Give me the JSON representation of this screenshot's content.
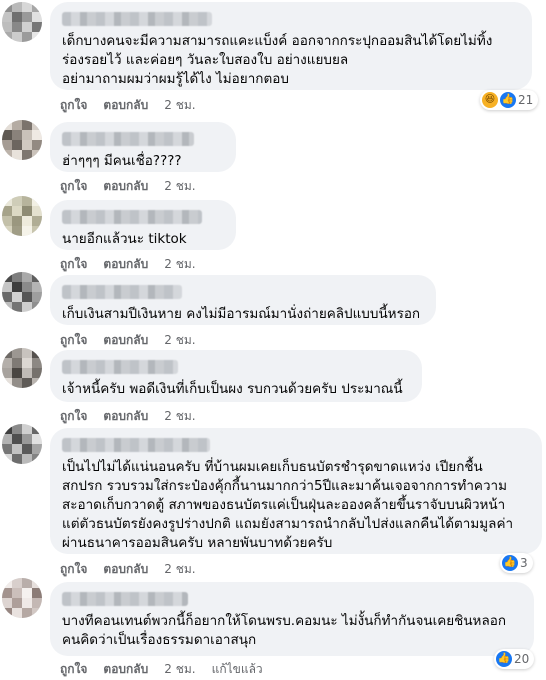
{
  "comments": [
    {
      "text": "เด็กบางคนจะมีความสามารถแคะแบ็งค์ ออกจากกระปุกออมสินได้โดยไม่ทิ้ง\nร่องรอยไว้ และค่อยๆ วันละใบสองใบ อย่างแยบยล\nอย่ามาถามผมว่าผมรู้ได้ไง ไม่อยากตอบ",
      "like": "ถูกใจ",
      "reply": "ตอบกลับ",
      "time": "2 ชม.",
      "reactions": {
        "icons": [
          "haha-icon",
          "like-icon"
        ],
        "count": "21"
      }
    },
    {
      "text": "ฮ่าๆๆๆ มีคนเชื่อ????",
      "like": "ถูกใจ",
      "reply": "ตอบกลับ",
      "time": "2 ชม."
    },
    {
      "text": "นายอีกแล้วนะ tiktok",
      "like": "ถูกใจ",
      "reply": "ตอบกลับ",
      "time": "2 ชม."
    },
    {
      "text": "เก็บเงินสามปีเงินหาย คงไม่มีอารมณ์มานั่งถ่ายคลิปแบบนี้หรอก",
      "like": "ถูกใจ",
      "reply": "ตอบกลับ",
      "time": "2 ชม."
    },
    {
      "text": "เจ้าหนี้ครับ พอดีเงินที่เก็บเป็นผง รบกวนด้วยครับ ประมาณนี้",
      "like": "ถูกใจ",
      "reply": "ตอบกลับ",
      "time": "2 ชม."
    },
    {
      "text": "เป็นไปไม่ได้แน่นอนครับ ที่บ้านผมเคยเก็บธนบัตรชำรุดขาดแหว่ง เปียกชื้น\nสกปรก รวบรวมใส่กระป๋องคุ้กกี้นานมากกว่า5ปีและมาค้นเจอจากการทำความ\nสะอาดเก็บกวาดตู้ สภาพของธนบัตรแค่เป็นฝุ่นละอองคล้ายขึ้นราจับบนผิวหน้า\nแต่ตัวธนบัตรยังคงรูปร่างปกติ แถมยังสามารถนำกลับไปส่งแลกคืนได้ตามมูลค่า\nผ่านธนาคารออมสินครับ หลายพันบาทด้วยครับ",
      "like": "ถูกใจ",
      "reply": "ตอบกลับ",
      "time": "2 ชม.",
      "reactions": {
        "icons": [
          "like-icon"
        ],
        "count": "3"
      }
    },
    {
      "text": "บางทีคอนเทนต์พวกนี้ก็อยากให้โดนพรบ.คอมนะ ไม่งั้นก็ทำกันจนเคยชินหลอก\nคนคิดว่าเป็นเรื่องธรรมดาเอาสนุก",
      "like": "ถูกใจ",
      "reply": "ตอบกลับ",
      "time": "2 ชม.",
      "edited": "แก้ไขแล้ว",
      "reactions": {
        "icons": [
          "like-icon"
        ],
        "count": "20"
      }
    }
  ]
}
